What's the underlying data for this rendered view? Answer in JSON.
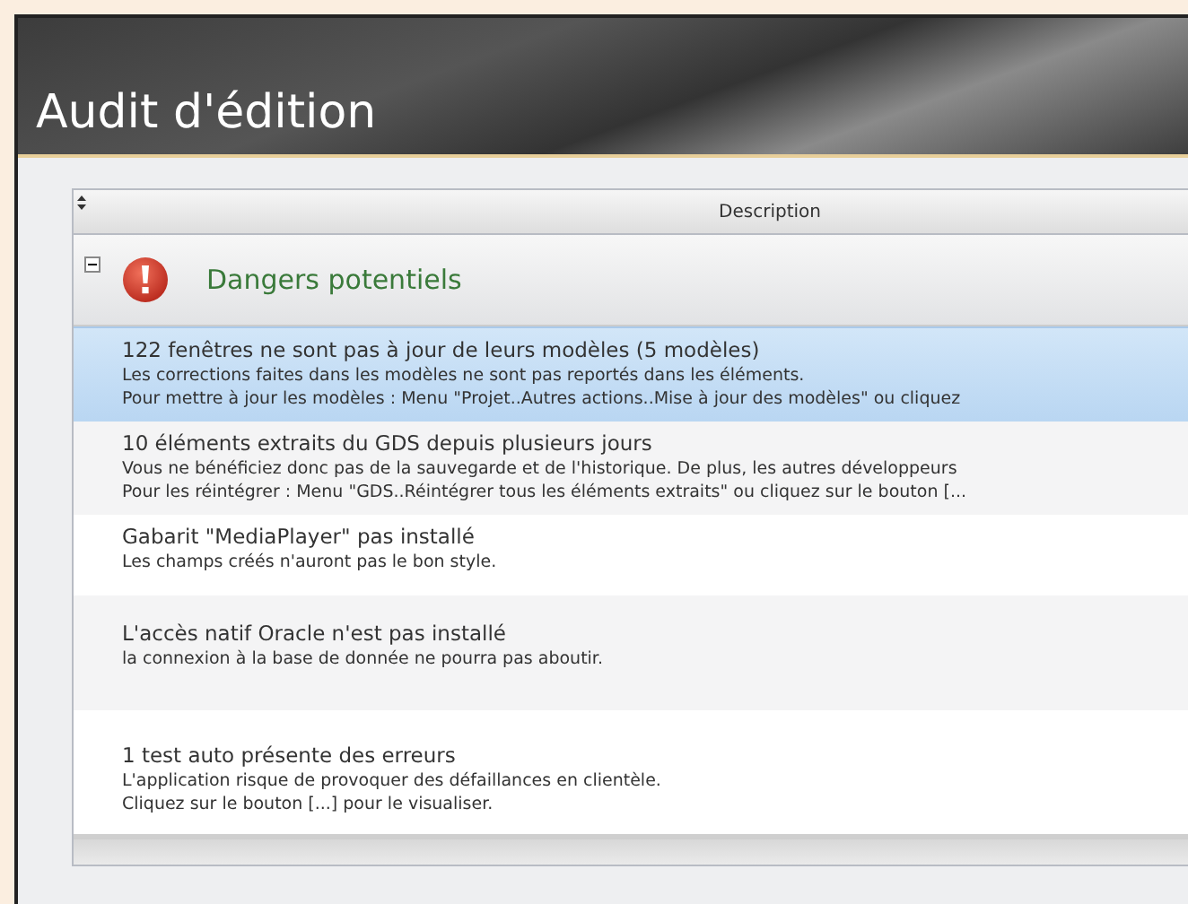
{
  "window": {
    "title": "Audit d'édition"
  },
  "table": {
    "columns": [
      {
        "label": "Description"
      }
    ],
    "groups": [
      {
        "title": "Dangers potentiels",
        "expanded": true,
        "rows": [
          {
            "title": "122 fenêtres ne sont pas à jour de leurs modèles (5 modèles)",
            "lines": [
              "Les corrections faites dans les modèles ne sont pas reportés dans les éléments.",
              "Pour mettre à jour les modèles : Menu \"Projet..Autres actions..Mise à jour des modèles\" ou cliquez"
            ],
            "selected": true
          },
          {
            "title": "10 éléments extraits du GDS depuis plusieurs jours",
            "lines": [
              "Vous ne bénéficiez donc pas de la sauvegarde et de l'historique. De plus, les autres développeurs",
              "Pour les réintégrer : Menu \"GDS..Réintégrer tous les éléments extraits\" ou cliquez sur le bouton [..."
            ],
            "selected": false
          },
          {
            "title": "Gabarit \"MediaPlayer\" pas installé",
            "lines": [
              "Les champs créés n'auront pas le bon style."
            ],
            "selected": false
          },
          {
            "title": "L'accès natif Oracle n'est pas installé",
            "lines": [
              "la connexion à la base de donnée ne pourra pas aboutir."
            ],
            "selected": false
          },
          {
            "title": "1 test auto présente des erreurs",
            "lines": [
              "L'application risque de provoquer des défaillances en clientèle.",
              "Cliquez sur le bouton [...] pour le visualiser."
            ],
            "selected": false
          }
        ]
      }
    ]
  }
}
